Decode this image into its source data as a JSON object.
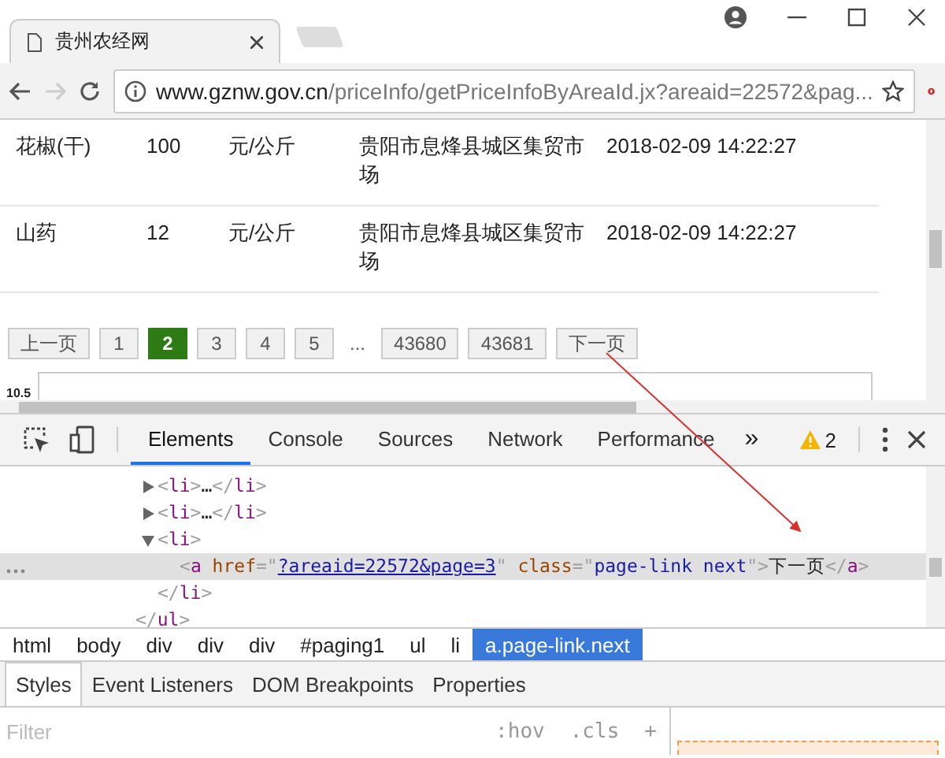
{
  "browser": {
    "tab_title": "贵州农经网",
    "back_disabled": false,
    "forward_disabled": true,
    "url_host": "www.gznw.gov.cn",
    "url_path": "/priceInfo/getPriceInfoByAreaId.jx?areaid=22572&pag..."
  },
  "table": {
    "rows": [
      {
        "product": "花椒(干)",
        "price": "100",
        "unit": "元/公斤",
        "market": "贵阳市息烽县城区集贸市场",
        "time": "2018-02-09 14:22:27"
      },
      {
        "product": "山药",
        "price": "12",
        "unit": "元/公斤",
        "market": "贵阳市息烽县城区集贸市场",
        "time": "2018-02-09 14:22:27"
      }
    ]
  },
  "pagination": [
    {
      "kind": "nav",
      "label": "上一页",
      "selected": false
    },
    {
      "kind": "page",
      "label": "1",
      "selected": false
    },
    {
      "kind": "page",
      "label": "2",
      "selected": true
    },
    {
      "kind": "page",
      "label": "3",
      "selected": false
    },
    {
      "kind": "page",
      "label": "4",
      "selected": false
    },
    {
      "kind": "page",
      "label": "5",
      "selected": false
    },
    {
      "kind": "ellipsis",
      "label": "..."
    },
    {
      "kind": "page",
      "label": "43680",
      "selected": false
    },
    {
      "kind": "page",
      "label": "43681",
      "selected": false
    },
    {
      "kind": "nav",
      "label": "下一页",
      "selected": false
    }
  ],
  "chart_stub": {
    "axis_label": "10.5"
  },
  "devtools": {
    "tabs": [
      {
        "label": "Elements",
        "selected": true
      },
      {
        "label": "Console",
        "selected": false
      },
      {
        "label": "Sources",
        "selected": false
      },
      {
        "label": "Network",
        "selected": false
      },
      {
        "label": "Performance",
        "selected": false
      }
    ],
    "more_tabs": "»",
    "warning_count": "2",
    "dom_tree": {
      "children": [
        {
          "expanded": false,
          "selected": false,
          "line": [
            {
              "kind": "bracket",
              "text": "<"
            },
            {
              "kind": "tag",
              "text": "li"
            },
            {
              "kind": "bracket",
              "text": ">"
            },
            {
              "kind": "text",
              "text": "…"
            },
            {
              "kind": "bracket",
              "text": "</"
            },
            {
              "kind": "tag",
              "text": "li"
            },
            {
              "kind": "bracket",
              "text": ">"
            }
          ]
        },
        {
          "expanded": false,
          "selected": false,
          "line": [
            {
              "kind": "bracket",
              "text": "<"
            },
            {
              "kind": "tag",
              "text": "li"
            },
            {
              "kind": "bracket",
              "text": ">"
            },
            {
              "kind": "text",
              "text": "…"
            },
            {
              "kind": "bracket",
              "text": "</"
            },
            {
              "kind": "tag",
              "text": "li"
            },
            {
              "kind": "bracket",
              "text": ">"
            }
          ]
        },
        {
          "expanded": true,
          "selected": false,
          "line": [
            {
              "kind": "bracket",
              "text": "<"
            },
            {
              "kind": "tag",
              "text": "li"
            },
            {
              "kind": "bracket",
              "text": ">"
            }
          ],
          "children": [
            {
              "selected": true,
              "line": [
                {
                  "kind": "bracket",
                  "text": "<"
                },
                {
                  "kind": "tag",
                  "text": "a"
                },
                {
                  "kind": "attr",
                  "text": " href"
                },
                {
                  "kind": "bracket",
                  "text": "=\""
                },
                {
                  "kind": "link",
                  "text": "?areaid=22572&page=3"
                },
                {
                  "kind": "bracket",
                  "text": "\""
                },
                {
                  "kind": "attr",
                  "text": " class"
                },
                {
                  "kind": "bracket",
                  "text": "=\""
                },
                {
                  "kind": "value",
                  "text": "page-link next"
                },
                {
                  "kind": "bracket",
                  "text": "\">"
                },
                {
                  "kind": "text",
                  "text": "下一页"
                },
                {
                  "kind": "bracket",
                  "text": "</"
                },
                {
                  "kind": "tag",
                  "text": "a"
                },
                {
                  "kind": "bracket",
                  "text": ">"
                }
              ]
            }
          ],
          "closing": [
            {
              "kind": "bracket",
              "text": "</"
            },
            {
              "kind": "tag",
              "text": "li"
            },
            {
              "kind": "bracket",
              "text": ">"
            }
          ]
        }
      ],
      "closing": [
        {
          "kind": "bracket",
          "text": "</"
        },
        {
          "kind": "tag",
          "text": "ul"
        },
        {
          "kind": "bracket",
          "text": ">"
        }
      ]
    },
    "breadcrumbs": [
      {
        "label": "html",
        "selected": false
      },
      {
        "label": "body",
        "selected": false
      },
      {
        "label": "div",
        "selected": false
      },
      {
        "label": "div",
        "selected": false
      },
      {
        "label": "div",
        "selected": false
      },
      {
        "label": "#paging1",
        "selected": false
      },
      {
        "label": "ul",
        "selected": false
      },
      {
        "label": "li",
        "selected": false
      },
      {
        "label": "a.page-link.next",
        "selected": true
      }
    ],
    "panel_tabs": [
      {
        "label": "Styles",
        "selected": true
      },
      {
        "label": "Event Listeners",
        "selected": false
      },
      {
        "label": "DOM Breakpoints",
        "selected": false
      },
      {
        "label": "Properties",
        "selected": false
      }
    ],
    "filter": {
      "placeholder": "Filter"
    },
    "filter_buttons": [
      ":hov",
      ".cls",
      "+"
    ]
  }
}
